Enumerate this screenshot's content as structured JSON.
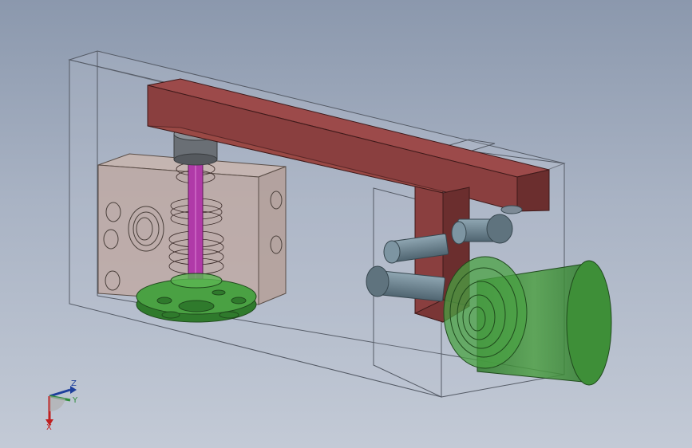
{
  "viewport": {
    "background": [
      "#8b98ad",
      "#c3cad6"
    ]
  },
  "model": {
    "colors": {
      "housing_fill": "#b9c1cf",
      "housing_edge": "#555b66",
      "lever": "#8a3f3f",
      "lever_top": "#9c4a4a",
      "lever_dark": "#6b2e2e",
      "block": "#c2a79c",
      "rod": "#b03aa8",
      "wheel": "#3f8f3a",
      "pin": "#6f8794",
      "cap": "#6a6f75"
    }
  },
  "triad": {
    "z_label": "Z",
    "y_label": "Y",
    "x_label": "X",
    "colors": {
      "z": "#1d3f9c",
      "y": "#2e8b3a",
      "x": "#c02020"
    }
  }
}
